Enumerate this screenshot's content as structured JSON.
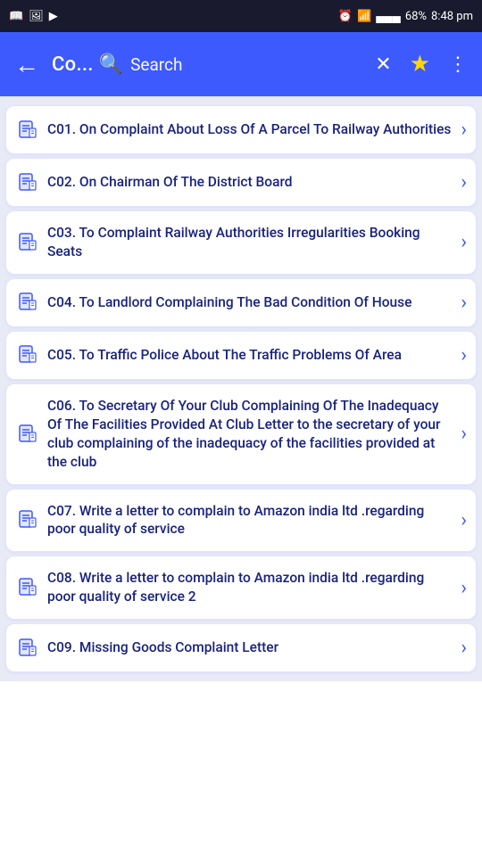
{
  "statusBar": {
    "time": "8:48 pm",
    "battery": "68%",
    "signal": "▄▄▄",
    "icons": [
      "book",
      "image",
      "youtube"
    ]
  },
  "appBar": {
    "backLabel": "←",
    "title": "Co...",
    "searchPlaceholder": "Search",
    "closeLabel": "✕",
    "starLabel": "★",
    "menuLabel": "⋮"
  },
  "listItems": [
    {
      "id": "c01",
      "text": "C01. On Complaint About Loss Of A Parcel To Railway Authorities"
    },
    {
      "id": "c02",
      "text": "C02. On Chairman Of The District Board"
    },
    {
      "id": "c03",
      "text": "C03. To Complaint Railway Authorities Irregularities Booking Seats"
    },
    {
      "id": "c04",
      "text": "C04. To Landlord Complaining The Bad Condition Of House"
    },
    {
      "id": "c05",
      "text": "C05. To Traffic Police About The Traffic Problems Of Area"
    },
    {
      "id": "c06",
      "text": "C06. To Secretary Of Your Club Complaining Of The Inadequacy Of The Facilities Provided At Club Letter to the secretary of your club complaining of the inadequacy of the facilities provided at the club"
    },
    {
      "id": "c07",
      "text": "C07. Write a letter to complain to Amazon india ltd .regarding poor quality of service"
    },
    {
      "id": "c08",
      "text": "C08. Write a letter to complain to Amazon india ltd .regarding poor quality of service 2"
    },
    {
      "id": "c09",
      "text": "C09. Missing Goods Complaint Letter"
    }
  ]
}
